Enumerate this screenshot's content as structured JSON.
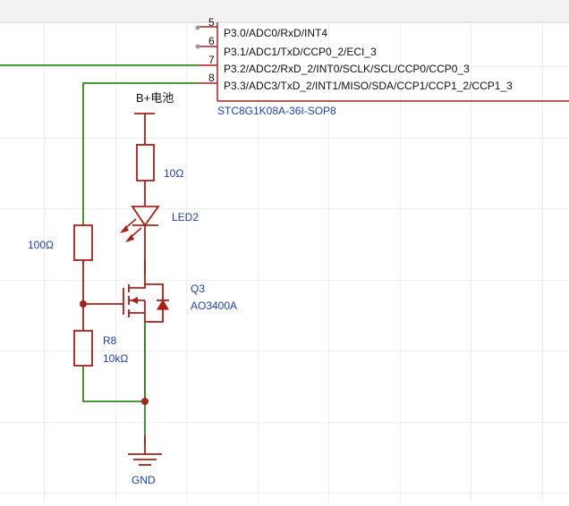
{
  "colors": {
    "background": "#ffffff",
    "grid": "#dcdcdc",
    "topbar": "#f2f2f2",
    "wire": "#2e8b1e",
    "component": "#a8201a",
    "label": "#1f3fa6",
    "text": "#111111",
    "pin_dot": "#9a9a9a"
  },
  "chip": {
    "part_number": "STC8G1K08A-36I-SOP8",
    "pins": [
      {
        "number": "5",
        "name": "P3.0/ADC0/RxD/INT4"
      },
      {
        "number": "6",
        "name": "P3.1/ADC1/TxD/CCP0_2/ECI_3"
      },
      {
        "number": "7",
        "name": "P3.2/ADC2/RxD_2/INT0/SCLK/SCL/CCP0/CCP0_3"
      },
      {
        "number": "8",
        "name": "P3.3/ADC3/TxD_2/INT1/MISO/SDA/CCP1/CCP1_2/CCP1_3"
      }
    ]
  },
  "power": {
    "label": "B+电池"
  },
  "resistor_top": {
    "value": "10Ω"
  },
  "led": {
    "designator": "LED2"
  },
  "resistor_gate": {
    "value": "100Ω"
  },
  "mosfet": {
    "designator": "Q3",
    "part": "AO3400A"
  },
  "resistor_pulldown": {
    "designator": "R8",
    "value": "10kΩ"
  },
  "ground": {
    "label": "GND"
  }
}
